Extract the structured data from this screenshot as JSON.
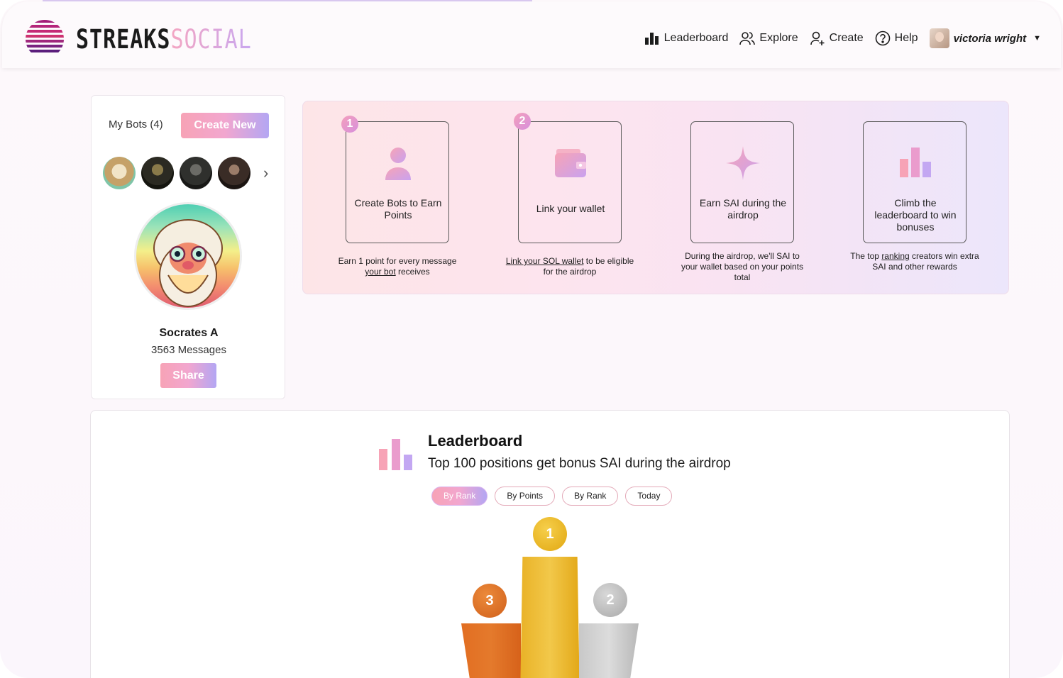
{
  "brand": {
    "name_part1": "STREAKS",
    "name_part2": "SOCIAL"
  },
  "nav": {
    "items": [
      {
        "label": "Leaderboard",
        "icon": "bar-chart-icon"
      },
      {
        "label": "Explore",
        "icon": "users-icon"
      },
      {
        "label": "Create",
        "icon": "user-plus-icon"
      },
      {
        "label": "Help",
        "icon": "help-circle-icon"
      }
    ],
    "user": {
      "name": "victoria wright",
      "icon": "chevron-down-icon"
    }
  },
  "my_bots": {
    "label": "My Bots (4)",
    "create_label": "Create New",
    "selected": {
      "name": "Socrates A",
      "messages": "3563 Messages",
      "share_label": "Share"
    }
  },
  "steps": [
    {
      "num": "1",
      "title": "Create Bots to Earn Points",
      "desc_pre": "Earn 1 point for every message ",
      "desc_link": "your bot",
      "desc_post": " receives",
      "icon": "person-icon"
    },
    {
      "num": "2",
      "title": "Link your wallet",
      "desc_pre": "",
      "desc_link": "Link your SOL wallet",
      "desc_post": " to be eligible for the airdrop",
      "icon": "wallet-icon"
    },
    {
      "num": "",
      "title": "Earn SAI during the airdrop",
      "desc_pre": "During the airdrop, we'll SAI to your wallet based on your points total",
      "desc_link": "",
      "desc_post": "",
      "icon": "sparkle-icon"
    },
    {
      "num": "",
      "title": "Climb the leaderboard to win bonuses",
      "desc_pre": "The top ",
      "desc_link": "ranking",
      "desc_post": " creators win extra SAI and other rewards",
      "icon": "bar-chart-icon"
    }
  ],
  "leaderboard": {
    "title": "Leaderboard",
    "subtitle": "Top 100 positions get bonus SAI during the airdrop",
    "filters": [
      "By Rank",
      "By Points",
      "By Rank",
      "Today"
    ],
    "active_filter": 0,
    "podium": {
      "first": "1",
      "second": "2",
      "third": "3"
    }
  },
  "colors": {
    "accent_start": "#f7a3b6",
    "accent_end": "#b3a6f3",
    "gold": "#e9b227",
    "silver": "#c8c8c8",
    "bronze": "#e26e22"
  }
}
